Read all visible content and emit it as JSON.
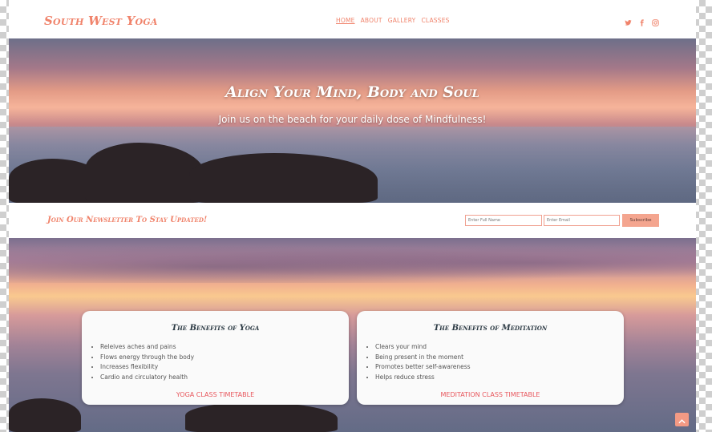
{
  "header": {
    "brand": "South West Yoga",
    "nav": [
      "HOME",
      "ABOUT",
      "GALLERY",
      "CLASSES"
    ],
    "social_icons": [
      "twitter-icon",
      "facebook-icon",
      "instagram-icon"
    ]
  },
  "hero": {
    "title": "Align Your Mind, Body and Soul",
    "subtitle": "Join us on the beach for your daily dose of Mindfulness!"
  },
  "newsletter": {
    "title": "Join Our Newsletter To Stay Updated!",
    "name_placeholder": "Enter Full Name",
    "email_placeholder": "Enter Email",
    "subscribe_label": "Subscribe"
  },
  "cards": {
    "yoga": {
      "title": "The Benefits of Yoga",
      "items": [
        "Releives aches and pains",
        "Flows energy through the body",
        "Increases flexibility",
        "Cardio and circulatory health"
      ],
      "link": "YOGA CLASS TIMETABLE"
    },
    "meditation": {
      "title": "The Benefits of Meditation",
      "items": [
        "Clears your mind",
        "Being present in the moment",
        "Promotes better self-awareness",
        "Helps reduce stress"
      ],
      "link": "MEDITATION CLASS TIMETABLE"
    }
  },
  "colors": {
    "accent": "#f0836b",
    "link": "#e8575d",
    "button": "#f4a58f",
    "heading": "#2c3a44"
  }
}
